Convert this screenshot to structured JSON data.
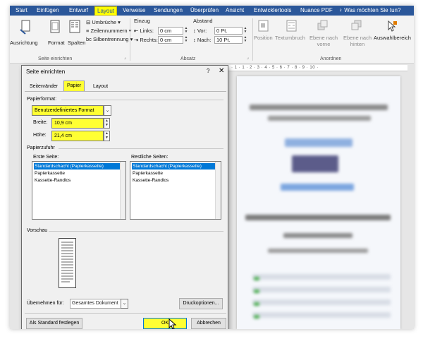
{
  "ribbon_tabs": [
    "Start",
    "Einfügen",
    "Entwurf",
    "Layout",
    "Verweise",
    "Sendungen",
    "Überprüfen",
    "Ansicht",
    "Entwicklertools",
    "Nuance PDF"
  ],
  "ribbon_search": "Was möchten Sie tun?",
  "ribbon": {
    "page_setup": {
      "orientation": "Ausrichtung",
      "format": "Format",
      "columns": "Spalten",
      "breaks": "Umbrüche",
      "line_numbers": "Zeilennummern",
      "hyphenation": "Silbentrennung",
      "group": "Seite einrichten"
    },
    "paragraph": {
      "indent": "Einzug",
      "spacing": "Abstand",
      "left_label": "Links:",
      "left_value": "0 cm",
      "right_label": "Rechts:",
      "right_value": "0 cm",
      "before_label": "Vor:",
      "before_value": "0 Pt.",
      "after_label": "Nach:",
      "after_value": "10 Pt.",
      "group": "Absatz"
    },
    "arrange": {
      "position": "Position",
      "text_wrap": "Textumbruch",
      "forward": "Ebene nach vorne",
      "backward": "Ebene nach hinten",
      "selection": "Auswahlbereich",
      "group": "Anordnen"
    }
  },
  "ruler": "· 1 · 1 · 2 · 3 · 4 · 5 · 6 · 7 · 8 · 9 · 10 ·",
  "dialog": {
    "title": "Seite einrichten",
    "help": "?",
    "close": "✕",
    "tabs": [
      "Seitenränder",
      "Papier",
      "Layout"
    ],
    "active_tab": "Papier",
    "paper_format_label": "Papierformat:",
    "paper_format_value": "Benutzerdefiniertes Format",
    "width_label": "Breite:",
    "width_value": "10,9 cm",
    "height_label": "Höhe:",
    "height_value": "21,4 cm",
    "paper_source_label": "Papierzufuhr",
    "first_page_label": "Erste Seite:",
    "other_pages_label": "Restliche Seiten:",
    "first_page_items": [
      "Standardschacht (Papierkassette)",
      "Papierkassette",
      "Kassette-Randlos"
    ],
    "other_pages_items": [
      "Standardschacht (Papierkassette)",
      "Papierkassette",
      "Kassette-Randlos"
    ],
    "preview_label": "Vorschau",
    "apply_to_label": "Übernehmen für:",
    "apply_to_value": "Gesamtes Dokument",
    "print_options": "Druckoptionen...",
    "set_default": "Als Standard festlegen",
    "ok": "OK",
    "cancel": "Abbrechen"
  },
  "colors": {
    "ribbon_blue": "#2b579a",
    "highlight_yellow": "#ffff33",
    "selection_blue": "#0078d7"
  }
}
